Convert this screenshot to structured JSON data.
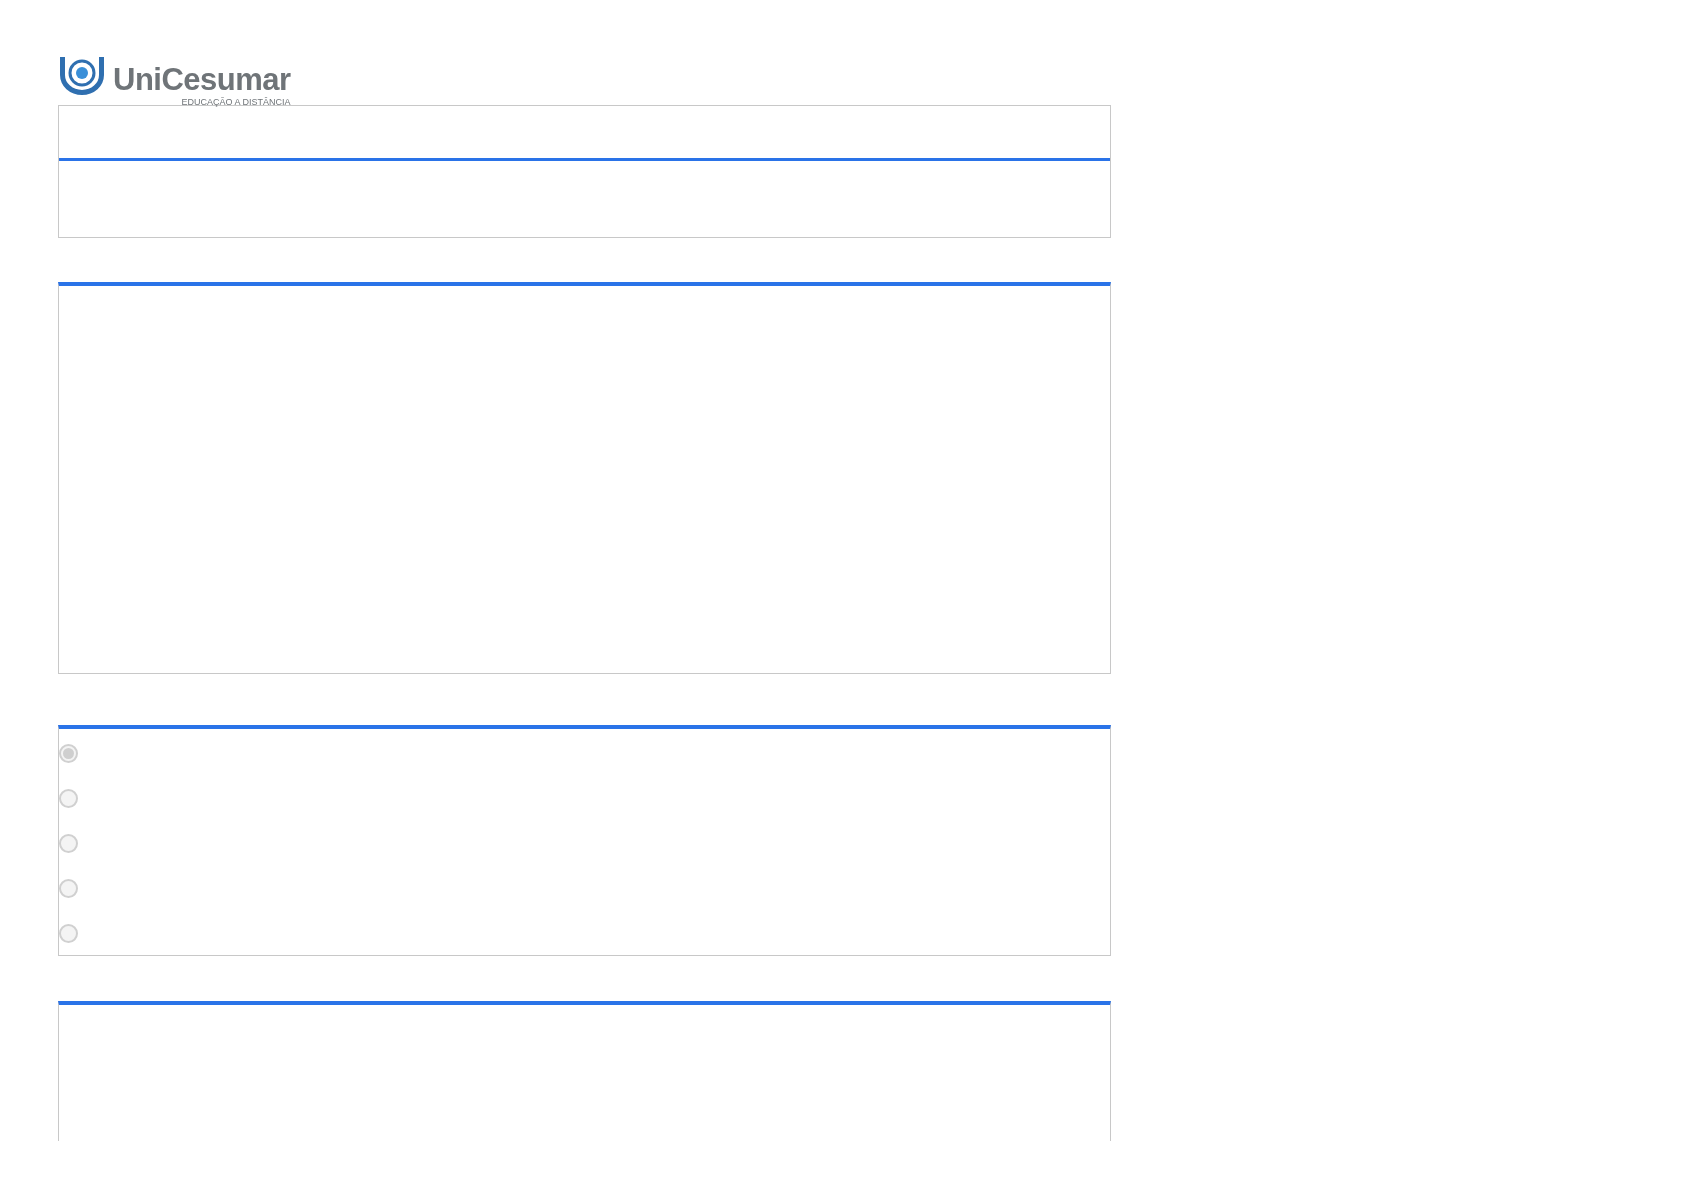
{
  "logo": {
    "name": "UniCesumar",
    "tagline": "EDUCAÇÃO A DISTÂNCIA"
  },
  "options": [
    {
      "selected": true
    },
    {
      "selected": false
    },
    {
      "selected": false
    },
    {
      "selected": false
    },
    {
      "selected": false
    }
  ]
}
